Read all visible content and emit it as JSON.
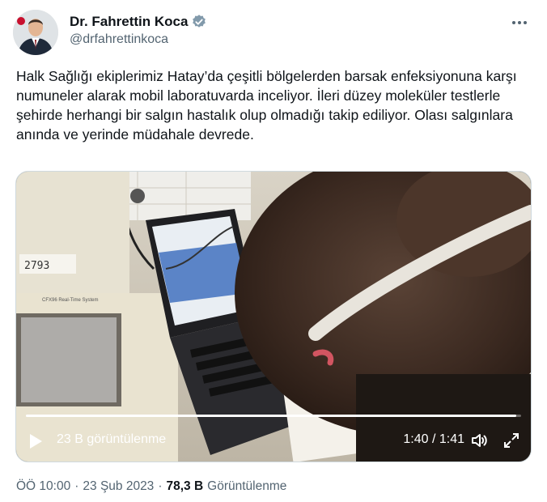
{
  "author": {
    "name": "Dr. Fahrettin Koca",
    "handle": "@drfahrettinkoca"
  },
  "tweet": {
    "text": "Halk Sağlığı ekiplerimiz Hatay’da çeşitli bölgelerden barsak enfeksiyonuna karşı numuneler alarak mobil laboratuvarda inceliyor. İleri düzey moleküler testlerle şehirde herhangi bir salgın hastalık olup olmadığı takip ediliyor. Olası salgınlara anında ve yerinde müdahale devrede."
  },
  "video": {
    "views_label": "23 B görüntülenme",
    "time": "1:40 / 1:41",
    "progress": 0.99,
    "sticker_text": "2793",
    "device_label": "CFX96 Real-Time System"
  },
  "meta": {
    "time": "ÖÖ 10:00",
    "sep1": "·",
    "date": "23 Şub 2023",
    "sep2": "·",
    "views_count": "78,3 B",
    "views_label": "Görüntülenme"
  },
  "icons": {
    "verified": "verified-badge-icon",
    "more": "more-options-icon",
    "play": "play-icon",
    "volume": "volume-icon",
    "fullscreen": "fullscreen-icon"
  },
  "colors": {
    "verified": "#829aab",
    "text": "#0f1419",
    "secondary": "#536471"
  }
}
